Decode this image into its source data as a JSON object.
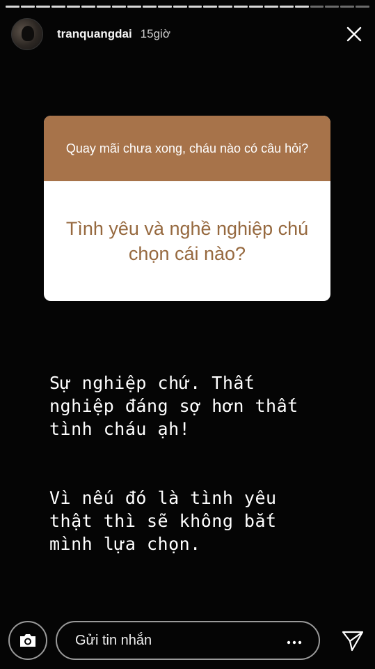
{
  "header": {
    "username": "tranquangdai",
    "time": "15giờ"
  },
  "question_card": {
    "prompt": "Quay mãi chưa xong, cháu nào có câu hỏi?",
    "question": "Tình yêu và nghề nghiệp chú chọn cái nào?",
    "colors": {
      "header_bg": "#a7734a",
      "question_text": "#96693f"
    }
  },
  "answer": {
    "paragraph1": "Sự nghiệp chứ. Thất\nnghiệp đáng sợ hơn thất\ntình cháu ạh!",
    "paragraph2": "Vì nếu đó là tình yêu\nthật thì sẽ không bắt\nmình lựa chọn."
  },
  "reply_bar": {
    "placeholder": "Gửi tin nhắn",
    "camera_icon": "camera-icon",
    "more_icon": "more-icon",
    "send_icon": "send-icon"
  },
  "progress": {
    "segments": 24,
    "viewed": 20
  }
}
